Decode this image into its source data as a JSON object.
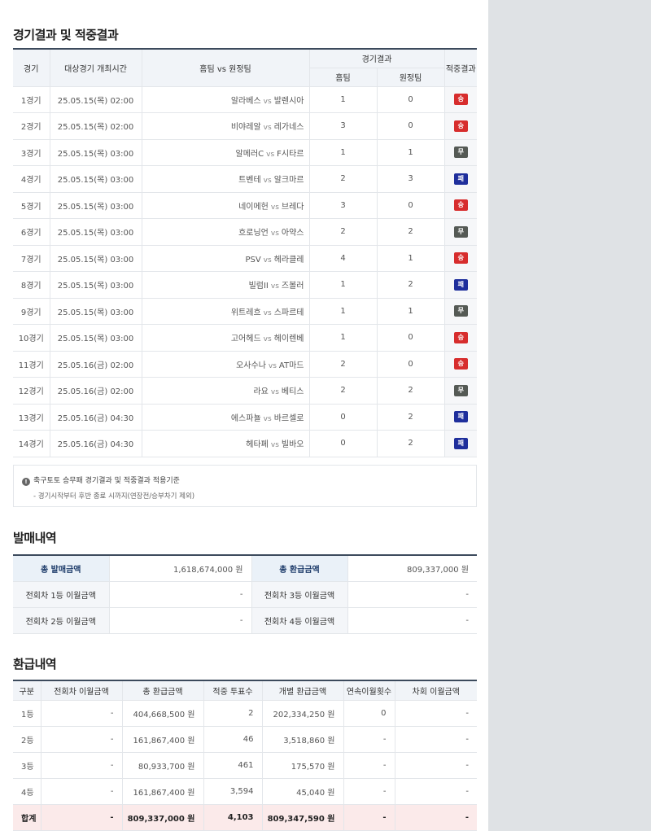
{
  "results_section": {
    "title": "경기결과 및 적중결과",
    "headers": {
      "game": "경기",
      "datetime": "대상경기 개최시간",
      "match": "홈팀 vs 원정팀",
      "result_group": "경기결과",
      "home": "홈팀",
      "away": "원정팀",
      "hit": "적중결과"
    },
    "vs_label": "vs",
    "rows": [
      {
        "game": "1경기",
        "datetime": "25.05.15(목) 02:00",
        "home_team": "알라베스",
        "away_team": "발렌시아",
        "home_score": "1",
        "away_score": "0",
        "result": "승",
        "result_type": "win"
      },
      {
        "game": "2경기",
        "datetime": "25.05.15(목) 02:00",
        "home_team": "비야레알",
        "away_team": "레가네스",
        "home_score": "3",
        "away_score": "0",
        "result": "승",
        "result_type": "win"
      },
      {
        "game": "3경기",
        "datetime": "25.05.15(목) 03:00",
        "home_team": "알메러C",
        "away_team": "F시타르",
        "home_score": "1",
        "away_score": "1",
        "result": "무",
        "result_type": "draw"
      },
      {
        "game": "4경기",
        "datetime": "25.05.15(목) 03:00",
        "home_team": "트벤테",
        "away_team": "알크마르",
        "home_score": "2",
        "away_score": "3",
        "result": "패",
        "result_type": "lose"
      },
      {
        "game": "5경기",
        "datetime": "25.05.15(목) 03:00",
        "home_team": "네이메헌",
        "away_team": "브레다",
        "home_score": "3",
        "away_score": "0",
        "result": "승",
        "result_type": "win"
      },
      {
        "game": "6경기",
        "datetime": "25.05.15(목) 03:00",
        "home_team": "흐로닝언",
        "away_team": "아약스",
        "home_score": "2",
        "away_score": "2",
        "result": "무",
        "result_type": "draw"
      },
      {
        "game": "7경기",
        "datetime": "25.05.15(목) 03:00",
        "home_team": "PSV",
        "away_team": "헤라클레",
        "home_score": "4",
        "away_score": "1",
        "result": "승",
        "result_type": "win"
      },
      {
        "game": "8경기",
        "datetime": "25.05.15(목) 03:00",
        "home_team": "빌럼II",
        "away_team": "즈볼러",
        "home_score": "1",
        "away_score": "2",
        "result": "패",
        "result_type": "lose"
      },
      {
        "game": "9경기",
        "datetime": "25.05.15(목) 03:00",
        "home_team": "위트레흐",
        "away_team": "스파르테",
        "home_score": "1",
        "away_score": "1",
        "result": "무",
        "result_type": "draw"
      },
      {
        "game": "10경기",
        "datetime": "25.05.15(목) 03:00",
        "home_team": "고어헤드",
        "away_team": "헤이렌베",
        "home_score": "1",
        "away_score": "0",
        "result": "승",
        "result_type": "win"
      },
      {
        "game": "11경기",
        "datetime": "25.05.16(금) 02:00",
        "home_team": "오사수나",
        "away_team": "AT마드",
        "home_score": "2",
        "away_score": "0",
        "result": "승",
        "result_type": "win"
      },
      {
        "game": "12경기",
        "datetime": "25.05.16(금) 02:00",
        "home_team": "라요",
        "away_team": "베티스",
        "home_score": "2",
        "away_score": "2",
        "result": "무",
        "result_type": "draw"
      },
      {
        "game": "13경기",
        "datetime": "25.05.16(금) 04:30",
        "home_team": "에스파뇰",
        "away_team": "바르셀로",
        "home_score": "0",
        "away_score": "2",
        "result": "패",
        "result_type": "lose"
      },
      {
        "game": "14경기",
        "datetime": "25.05.16(금) 04:30",
        "home_team": "헤타페",
        "away_team": "빌바오",
        "home_score": "0",
        "away_score": "2",
        "result": "패",
        "result_type": "lose"
      }
    ],
    "note": {
      "icon": "info-icon",
      "line1": "축구토토 승무패 경기결과 및 적중결과 적용기준",
      "line2": "- 경기시작부터 후반 종료 시까지(연장전/승부차기 제외)"
    }
  },
  "sales_section": {
    "title": "발매내역",
    "total_sales_label": "총 발매금액",
    "total_sales_value": "1,618,674,000 원",
    "total_refund_label": "총 환급금액",
    "total_refund_value": "809,337,000 원",
    "rows": [
      {
        "left_label": "전회차 1등 이월금액",
        "left_value": "-",
        "right_label": "전회차 3등 이월금액",
        "right_value": "-"
      },
      {
        "left_label": "전회차 2등 이월금액",
        "left_value": "-",
        "right_label": "전회차 4등 이월금액",
        "right_value": "-"
      }
    ]
  },
  "refund_section": {
    "title": "환급내역",
    "headers": [
      "구분",
      "전회차 이월금액",
      "총 환급금액",
      "적중 투표수",
      "개별 환급금액",
      "연속이월횟수",
      "차회 이월금액"
    ],
    "rows": [
      [
        "1등",
        "-",
        "404,668,500 원",
        "2",
        "202,334,250 원",
        "0",
        "-"
      ],
      [
        "2등",
        "-",
        "161,867,400 원",
        "46",
        "3,518,860 원",
        "-",
        "-"
      ],
      [
        "3등",
        "-",
        "80,933,700 원",
        "461",
        "175,570 원",
        "-",
        "-"
      ],
      [
        "4등",
        "-",
        "161,867,400 원",
        "3,594",
        "45,040 원",
        "-",
        "-"
      ]
    ],
    "total": [
      "합계",
      "-",
      "809,337,000 원",
      "4,103",
      "809,347,590 원",
      "-",
      "-"
    ]
  }
}
